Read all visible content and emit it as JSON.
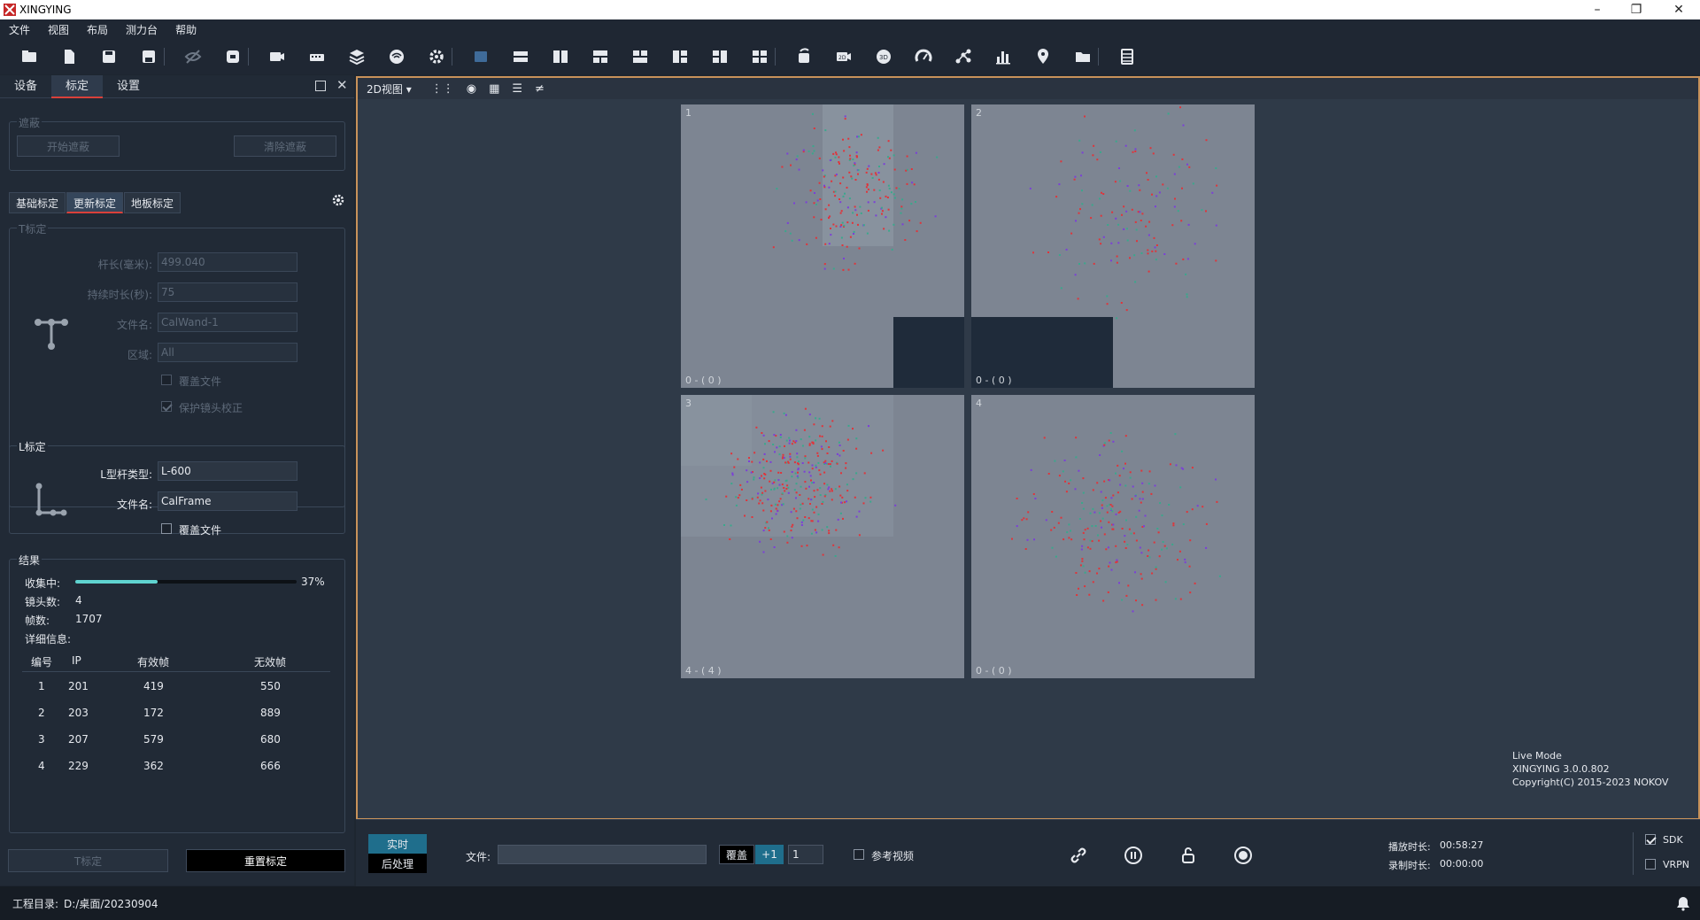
{
  "app": {
    "title": "XINGYING"
  },
  "menu": [
    "文件",
    "视图",
    "布局",
    "测力台",
    "帮助"
  ],
  "toolbar_icons": [
    "open-folder-icon",
    "new-file-icon",
    "save-icon",
    "save-as-icon",
    "visibility-off-icon",
    "refresh-icon",
    "camera-off-icon",
    "device-icon",
    "layers-icon",
    "wifi-icon",
    "settings-gear-icon",
    "layout-single-icon",
    "layout-horizontal-icon",
    "layout-vertical-icon",
    "layout-top-split-icon",
    "layout-bottom-split-icon",
    "layout-left-split-icon",
    "layout-right-split-icon",
    "layout-quad-icon",
    "rotate-camera-icon",
    "view-2d-icon",
    "view-3d-icon",
    "gauge-icon",
    "skeleton-icon",
    "bar-chart-icon",
    "location-pin-icon",
    "folder-icon",
    "list-panel-icon"
  ],
  "left_tabs": [
    "设备",
    "标定",
    "设置"
  ],
  "mask": {
    "title": "遮蔽",
    "start": "开始遮蔽",
    "clear": "清除遮蔽"
  },
  "calib_tabs": [
    "基础标定",
    "更新标定",
    "地板标定"
  ],
  "t_calib": {
    "title": "T标定",
    "wand_len_label": "杆长(毫米):",
    "wand_len": "499.040",
    "duration_label": "持续时长(秒):",
    "duration": "75",
    "file_label": "文件名:",
    "file": "CalWand-1",
    "region_label": "区域:",
    "region": "All",
    "overwrite": "覆盖文件",
    "protect": "保护镜头校正"
  },
  "l_calib": {
    "title": "L标定",
    "type_label": "L型杆类型:",
    "type": "L-600",
    "file_label": "文件名:",
    "file": "CalFrame",
    "overwrite": "覆盖文件"
  },
  "results": {
    "title": "结果",
    "collecting_label": "收集中:",
    "progress": 0.37,
    "progress_text": "37%",
    "cameras_label": "镜头数:",
    "cameras": "4",
    "frames_label": "帧数:",
    "frames": "1707",
    "detail_label": "详细信息:",
    "headers": [
      "编号",
      "IP",
      "有效帧",
      "无效帧"
    ],
    "rows": [
      [
        "1",
        "201",
        "419",
        "550"
      ],
      [
        "2",
        "203",
        "172",
        "889"
      ],
      [
        "3",
        "207",
        "579",
        "680"
      ],
      [
        "4",
        "229",
        "362",
        "666"
      ]
    ]
  },
  "buttons": {
    "t_calib": "T标定",
    "reset": "重置标定"
  },
  "viewport": {
    "view_mode": "2D视图",
    "cams": [
      {
        "num": "1",
        "foot": "0 - ( 0 )"
      },
      {
        "num": "2",
        "foot": "0 - ( 0 )"
      },
      {
        "num": "3",
        "foot": "4 - ( 4 )"
      },
      {
        "num": "4",
        "foot": "0 - ( 0 )"
      }
    ],
    "live_mode": "Live Mode",
    "version": "XINGYING 3.0.0.802",
    "copyright": "Copyright(C) 2015-2023 NOKOV"
  },
  "bottom": {
    "realtime": "实时",
    "post": "后处理",
    "file_label": "文件:",
    "overlay": "覆盖",
    "plus_one": "+1",
    "step": "1",
    "ref_video": "参考视频",
    "play_label": "播放时长:",
    "play_time": "00:58:27",
    "rec_label": "录制时长:",
    "rec_time": "00:00:00",
    "sdk": "SDK",
    "vrpn": "VRPN"
  },
  "status": {
    "project_label": "工程目录:",
    "project_path": "D:/桌面/20230904"
  },
  "colors": {
    "accent_red": "#d9403a",
    "progress": "#5fd3d0",
    "viewport_border": "#c8925a"
  }
}
